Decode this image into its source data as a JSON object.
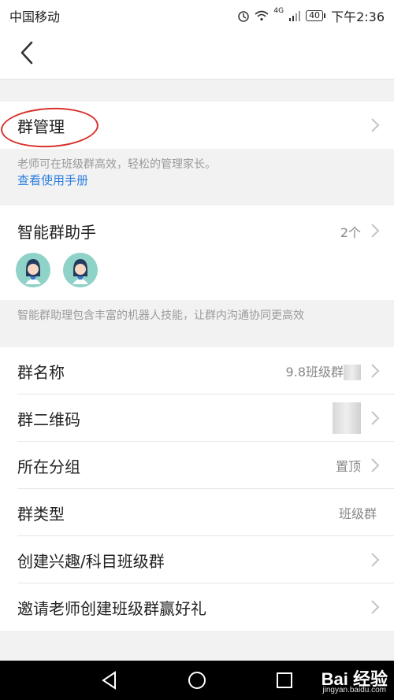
{
  "status_bar": {
    "carrier": "中国移动",
    "network": "4G",
    "battery": "40",
    "time": "下午2:36"
  },
  "group_manage": {
    "label": "群管理",
    "note": "老师可在班级群高效，轻松的管理家长。",
    "link": "查看使用手册"
  },
  "assistant": {
    "label": "智能群助手",
    "count": "2个",
    "note": "智能群助理包含丰富的机器人技能，让群内沟通协同更高效"
  },
  "settings": [
    {
      "label": "群名称",
      "value": "9.8班级群"
    },
    {
      "label": "群二维码",
      "value": ""
    },
    {
      "label": "所在分组",
      "value": "置顶"
    },
    {
      "label": "群类型",
      "value": "班级群"
    },
    {
      "label": "创建兴趣/科目班级群",
      "value": ""
    },
    {
      "label": "邀请老师创建班级群赢好礼",
      "value": ""
    }
  ],
  "watermark": {
    "brand": "Bai 经验",
    "url": "jingyan.baidu.com"
  },
  "colors": {
    "link": "#2d7fe0",
    "annotation": "#d9302b",
    "background": "#f2f2f2"
  }
}
